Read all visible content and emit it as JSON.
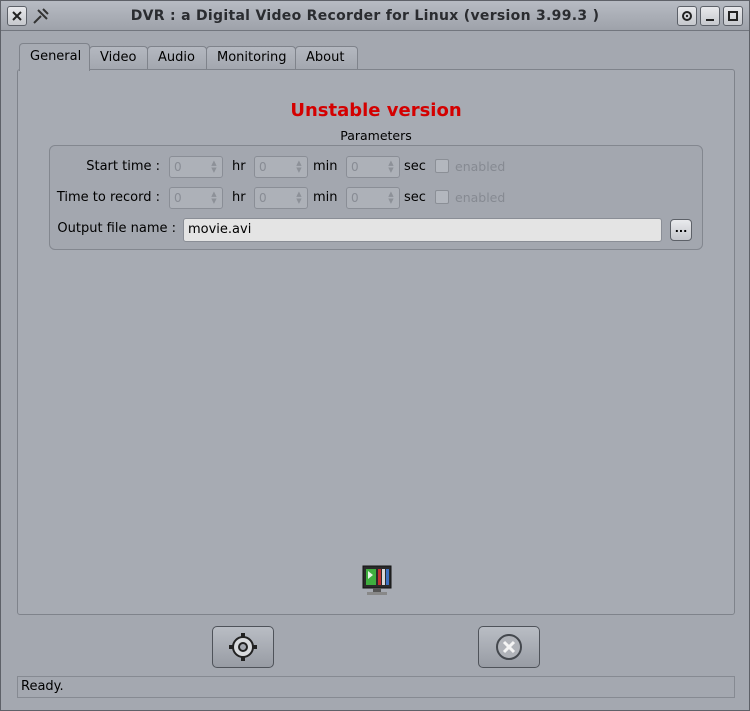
{
  "window": {
    "title": "DVR : a Digital Video Recorder for Linux (version 3.99.3 )"
  },
  "titlebar_icons": {
    "close": "close-icon",
    "pin": "pin-icon",
    "options": "gear-icon",
    "minimize": "minimize-icon",
    "maximize": "maximize-icon"
  },
  "tabs": [
    {
      "label": "General",
      "active": true
    },
    {
      "label": "Video",
      "active": false
    },
    {
      "label": "Audio",
      "active": false
    },
    {
      "label": "Monitoring",
      "active": false
    },
    {
      "label": "About",
      "active": false
    }
  ],
  "general": {
    "notice": "Unstable version",
    "notice_color": "#d40000",
    "params_label": "Parameters",
    "start_time": {
      "label": "Start time :",
      "hr": "0",
      "min": "0",
      "sec": "0",
      "hr_unit": "hr",
      "min_unit": "min",
      "sec_unit": "sec",
      "enabled_label": "enabled",
      "enabled": false
    },
    "time_to_record": {
      "label": "Time to record :",
      "hr": "0",
      "min": "0",
      "sec": "0",
      "hr_unit": "hr",
      "min_unit": "min",
      "sec_unit": "sec",
      "enabled_label": "enabled",
      "enabled": false
    },
    "output": {
      "label": "Output file name :",
      "value": "movie.avi",
      "browse_label": "..."
    }
  },
  "buttons": {
    "settings": "settings-gear-icon",
    "cancel": "cancel-icon"
  },
  "status": "Ready."
}
